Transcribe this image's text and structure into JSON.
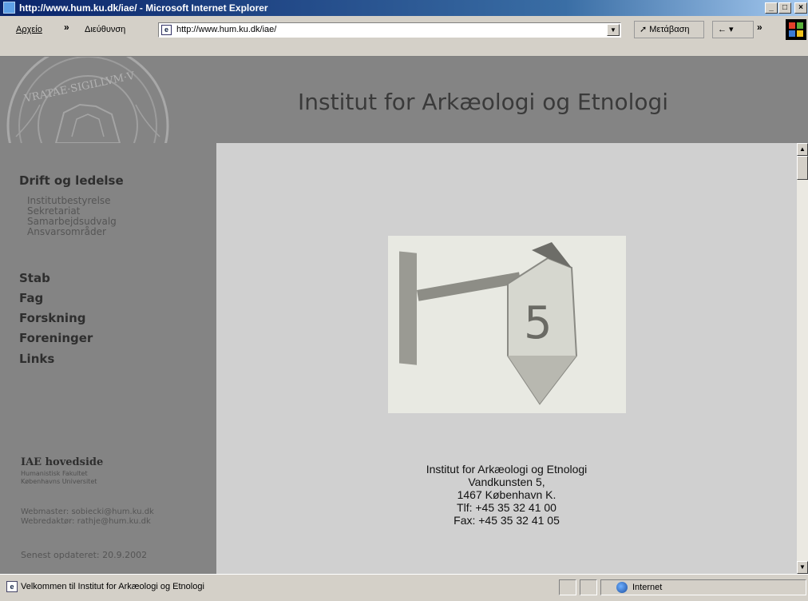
{
  "window": {
    "title": "http://www.hum.ku.dk/iae/ - Microsoft Internet Explorer",
    "minimize": "_",
    "maximize": "□",
    "close": "×"
  },
  "toolbar": {
    "file_menu": "Αρχείο",
    "chevron": "»",
    "address_label": "Διεύθυνση",
    "address_value": "http://www.hum.ku.dk/iae/",
    "go_label": "Μετάβαση",
    "links_label": "← ▾"
  },
  "header": {
    "site_title": "Institut for Arkæologi og Etnologi",
    "seal_text": "VRATAE·SIGILLVM·V"
  },
  "sidebar": {
    "section_drift": "Drift og ledelse",
    "drift_items": [
      "Institutbestyrelse",
      "Sekretariat",
      "Samarbejdsudvalg",
      "Ansvarsområder"
    ],
    "nav_items": [
      "Stab",
      "Fag",
      "Forskning",
      "Foreninger",
      "Links"
    ],
    "home_title": "IAE hovedside",
    "home_sub1": "Humanistisk Fakultet",
    "home_sub2": "Københavns Universitet",
    "webmaster": "Webmaster: sobiecki@hum.ku.dk",
    "webredaktor": "Webredaktør: rathje@hum.ku.dk",
    "updated": "Senest opdateret: 20.9.2002"
  },
  "content": {
    "photo_number": "5",
    "address_lines": [
      "Institut for Arkæologi og Etnologi",
      "Vandkunsten 5,",
      "1467 København K.",
      "Tlf: +45 35 32 41 00",
      "Fax: +45 35 32 41 05"
    ]
  },
  "statusbar": {
    "message": "Velkommen til Institut for Arkæologi og Etnologi",
    "zone": "Internet"
  },
  "colors": {
    "sidebar_bg": "#848484",
    "content_bg": "#d0d0d0",
    "titlebar": "#0a246a"
  }
}
